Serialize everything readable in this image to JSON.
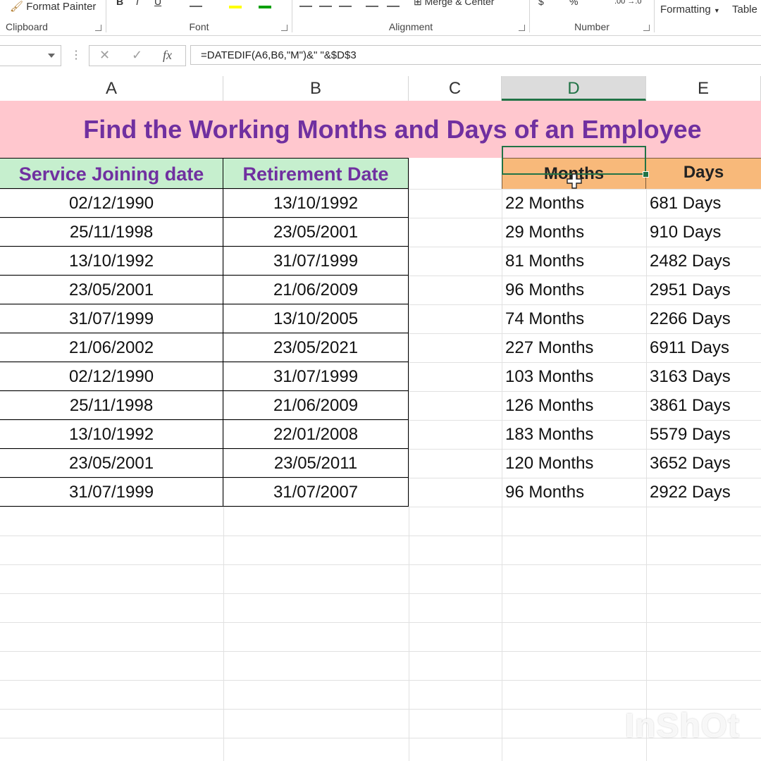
{
  "ribbon": {
    "format_painter": "Format Painter",
    "merge_center": "Merge & Center",
    "formatting": "Formatting",
    "table": "Table",
    "groups": {
      "clipboard": "Clipboard",
      "font": "Font",
      "alignment": "Alignment",
      "number": "Number"
    }
  },
  "formula_bar": {
    "name_box": "",
    "cancel_glyph": "✕",
    "enter_glyph": "✓",
    "fx_label": "fx",
    "formula": "=DATEDIF(A6,B6,\"M\")&\" \"&$D$3"
  },
  "columns": [
    "A",
    "B",
    "C",
    "D",
    "E"
  ],
  "title": "Find the Working Months and Days of an Employee",
  "headers": {
    "joining": "Service Joining date",
    "retirement": "Retirement Date",
    "months": "Months",
    "days": "Days"
  },
  "rows": [
    {
      "joining": "02/12/1990",
      "retirement": "13/10/1992",
      "months": "22 Months",
      "days": "681 Days"
    },
    {
      "joining": "25/11/1998",
      "retirement": "23/05/2001",
      "months": "29 Months",
      "days": "910 Days"
    },
    {
      "joining": "13/10/1992",
      "retirement": "31/07/1999",
      "months": "81 Months",
      "days": "2482 Days"
    },
    {
      "joining": "23/05/2001",
      "retirement": "21/06/2009",
      "months": "96 Months",
      "days": "2951 Days"
    },
    {
      "joining": "31/07/1999",
      "retirement": "13/10/2005",
      "months": "74 Months",
      "days": "2266 Days"
    },
    {
      "joining": "21/06/2002",
      "retirement": "23/05/2021",
      "months": "227 Months",
      "days": "6911 Days"
    },
    {
      "joining": "02/12/1990",
      "retirement": "31/07/1999",
      "months": "103 Months",
      "days": "3163 Days"
    },
    {
      "joining": "25/11/1998",
      "retirement": "21/06/2009",
      "months": "126 Months",
      "days": "3861 Days"
    },
    {
      "joining": "13/10/1992",
      "retirement": "22/01/2008",
      "months": "183 Months",
      "days": "5579 Days"
    },
    {
      "joining": "23/05/2001",
      "retirement": "23/05/2011",
      "months": "120 Months",
      "days": "3652 Days"
    },
    {
      "joining": "31/07/1999",
      "retirement": "31/07/2007",
      "months": "96 Months",
      "days": "2922 Days"
    }
  ],
  "selected_column": "D",
  "watermark": "InShOt",
  "colors": {
    "title_bg": "#ffc7ce",
    "title_text": "#7030a0",
    "green_header_bg": "#c6efce",
    "orange_header_bg": "#f8b97a",
    "selection": "#217346"
  }
}
